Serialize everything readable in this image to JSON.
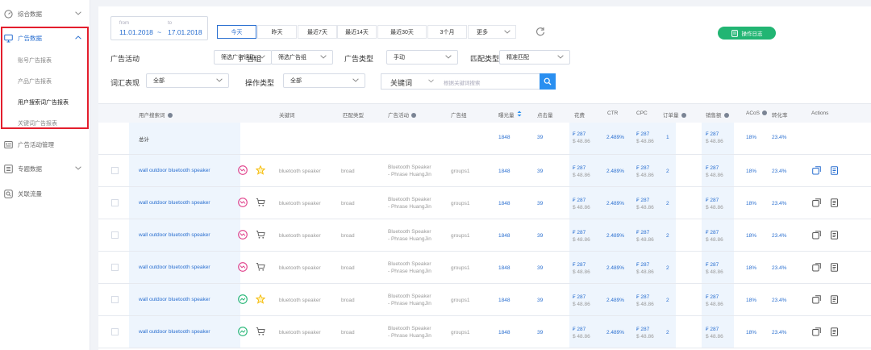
{
  "sidebar": {
    "items": [
      {
        "label": "综合数据",
        "icon": "dashboard-icon",
        "chevron": "down"
      },
      {
        "label": "广告数据",
        "icon": "monitor-icon",
        "chevron": "up",
        "active": true
      },
      {
        "label": "广告活动管理",
        "icon": "campaign-icon"
      },
      {
        "label": "专题数据",
        "icon": "list-icon",
        "chevron": "down"
      },
      {
        "label": "关联流量",
        "icon": "link-icon"
      }
    ],
    "subitems": [
      "账号广告报表",
      "产品广告报表",
      "用户搜索词广告报表",
      "关键词广告报表"
    ],
    "active_sub": 2
  },
  "date": {
    "from_label": "from",
    "to_label": "to",
    "from": "11.01.2018",
    "sep": "~",
    "to": "17.01.2018"
  },
  "quick_ranges": [
    "今天",
    "昨天",
    "最近7天",
    "最近14天",
    "最近30天",
    "3个月",
    "更多"
  ],
  "active_range": 0,
  "log_button": "操作日志",
  "filters": {
    "campaign": {
      "label": "广告活动",
      "value": "筛选广告活动"
    },
    "group": {
      "label": "广告组",
      "value": "筛选广告组"
    },
    "ad_type": {
      "label": "广告类型",
      "value": "手动"
    },
    "match_type": {
      "label": "匹配类型",
      "value": "精准匹配"
    },
    "word_perf": {
      "label": "词汇表现",
      "value": "全部"
    },
    "op_type": {
      "label": "操作类型",
      "value": "全部"
    },
    "keyword": {
      "label": "关键词",
      "placeholder": "根据关键词搜索"
    }
  },
  "table": {
    "headers": [
      "用户搜索词",
      "关键词",
      "匹配类型",
      "广告活动",
      "广告组",
      "曝光量",
      "点击量",
      "花费",
      "CTR",
      "CPC",
      "订单量",
      "销售额",
      "ACoS",
      "转化率",
      "Actions"
    ],
    "total_label": "总计",
    "total": {
      "impr": "1848",
      "clicks": "39",
      "spend1": "₣ 287",
      "spend2": "$ 48.86",
      "ctr": "2.489%",
      "cpc1": "₣ 287",
      "cpc2": "$ 48.86",
      "orders": "1",
      "sales1": "₣ 287",
      "sales2": "$ 48.86",
      "acos": "18%",
      "conv": "23.4%"
    },
    "rows": [
      {
        "term": "wall outdoor bluetooth speaker",
        "badge": "pink",
        "icon2": "star",
        "kw": "bluetooth speaker",
        "match": "broad",
        "camp1": "Bluetooth Speaker",
        "camp2": "- Phrase HuangJin",
        "grp": "groups1",
        "impr": "1848",
        "clicks": "39",
        "spend1": "₣ 287",
        "spend2": "$ 48.86",
        "ctr": "2.489%",
        "cpc1": "₣ 287",
        "cpc2": "$ 48.86",
        "orders": "2",
        "sales1": "₣ 287",
        "sales2": "$ 48.86",
        "acos": "18%",
        "conv": "23.4%",
        "active_actions": true
      },
      {
        "term": "wall outdoor bluetooth speaker",
        "badge": "pink",
        "icon2": "cart",
        "kw": "bluetooth speaker",
        "match": "broad",
        "camp1": "Bluetooth Speaker",
        "camp2": "- Phrase HuangJin",
        "grp": "groups1",
        "impr": "1848",
        "clicks": "39",
        "spend1": "₣ 287",
        "spend2": "$ 48.86",
        "ctr": "2.489%",
        "cpc1": "₣ 287",
        "cpc2": "$ 48.86",
        "orders": "2",
        "sales1": "₣ 287",
        "sales2": "$ 48.86",
        "acos": "18%",
        "conv": "23.4%"
      },
      {
        "term": "wall outdoor bluetooth speaker",
        "badge": "pink",
        "icon2": "cart",
        "kw": "bluetooth speaker",
        "match": "broad",
        "camp1": "Bluetooth Speaker",
        "camp2": "- Phrase HuangJin",
        "grp": "groups1",
        "impr": "1848",
        "clicks": "39",
        "spend1": "₣ 287",
        "spend2": "$ 48.86",
        "ctr": "2.489%",
        "cpc1": "₣ 287",
        "cpc2": "$ 48.86",
        "orders": "2",
        "sales1": "₣ 287",
        "sales2": "$ 48.86",
        "acos": "18%",
        "conv": "23.4%"
      },
      {
        "term": "wall outdoor bluetooth speaker",
        "badge": "pink",
        "icon2": "cart",
        "kw": "bluetooth speaker",
        "match": "broad",
        "camp1": "Bluetooth Speaker",
        "camp2": "- Phrase HuangJin",
        "grp": "groups1",
        "impr": "1848",
        "clicks": "39",
        "spend1": "₣ 287",
        "spend2": "$ 48.86",
        "ctr": "2.489%",
        "cpc1": "₣ 287",
        "cpc2": "$ 48.86",
        "orders": "2",
        "sales1": "₣ 287",
        "sales2": "$ 48.86",
        "acos": "18%",
        "conv": "23.4%"
      },
      {
        "term": "wall outdoor bluetooth speaker",
        "badge": "green",
        "icon2": "star",
        "kw": "bluetooth speaker",
        "match": "broad",
        "camp1": "Bluetooth Speaker",
        "camp2": "- Phrase HuangJin",
        "grp": "groups1",
        "impr": "1848",
        "clicks": "39",
        "spend1": "₣ 287",
        "spend2": "$ 48.86",
        "ctr": "2.489%",
        "cpc1": "₣ 287",
        "cpc2": "$ 48.86",
        "orders": "2",
        "sales1": "₣ 287",
        "sales2": "$ 48.86",
        "acos": "18%",
        "conv": "23.4%"
      },
      {
        "term": "wall outdoor bluetooth speaker",
        "badge": "green",
        "icon2": "cart",
        "kw": "bluetooth speaker",
        "match": "broad",
        "camp1": "Bluetooth Speaker",
        "camp2": "- Phrase HuangJin",
        "grp": "groups1",
        "impr": "1848",
        "clicks": "39",
        "spend1": "₣ 287",
        "spend2": "$ 48.86",
        "ctr": "2.489%",
        "cpc1": "₣ 287",
        "cpc2": "$ 48.86",
        "orders": "2",
        "sales1": "₣ 287",
        "sales2": "$ 48.86",
        "acos": "18%",
        "conv": "23.4%"
      }
    ]
  },
  "colors": {
    "accent": "#2a6fd0",
    "green": "#22b573",
    "highlight": "#e31e2d",
    "pink": "#e0408a",
    "star": "#f5b800"
  }
}
